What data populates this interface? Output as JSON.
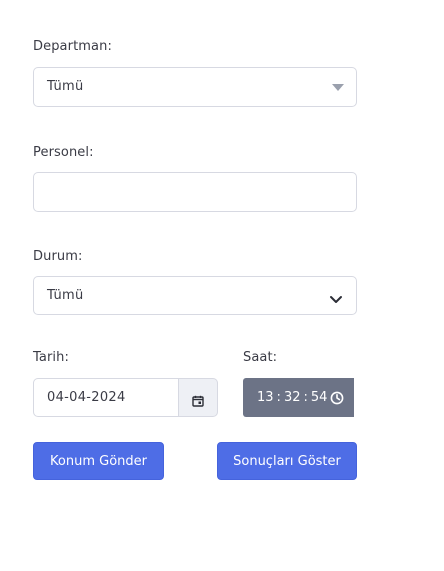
{
  "departman": {
    "label": "Departman:",
    "selected": "Tümü"
  },
  "personel": {
    "label": "Personel:",
    "value": ""
  },
  "durum": {
    "label": "Durum:",
    "selected": "Tümü"
  },
  "tarih": {
    "label": "Tarih:",
    "value": "04-04-2024",
    "icon": "calendar-icon"
  },
  "saat": {
    "label": "Saat:",
    "hour": "13",
    "minute": "32",
    "second": "54",
    "separator": ":",
    "icon": "clock-icon"
  },
  "buttons": {
    "send_location": "Konum Gönder",
    "show_results": "Sonuçları Göster"
  },
  "colors": {
    "primary": "#4e6de6",
    "time_bg": "#6c7386",
    "border": "#d7d9e2"
  }
}
